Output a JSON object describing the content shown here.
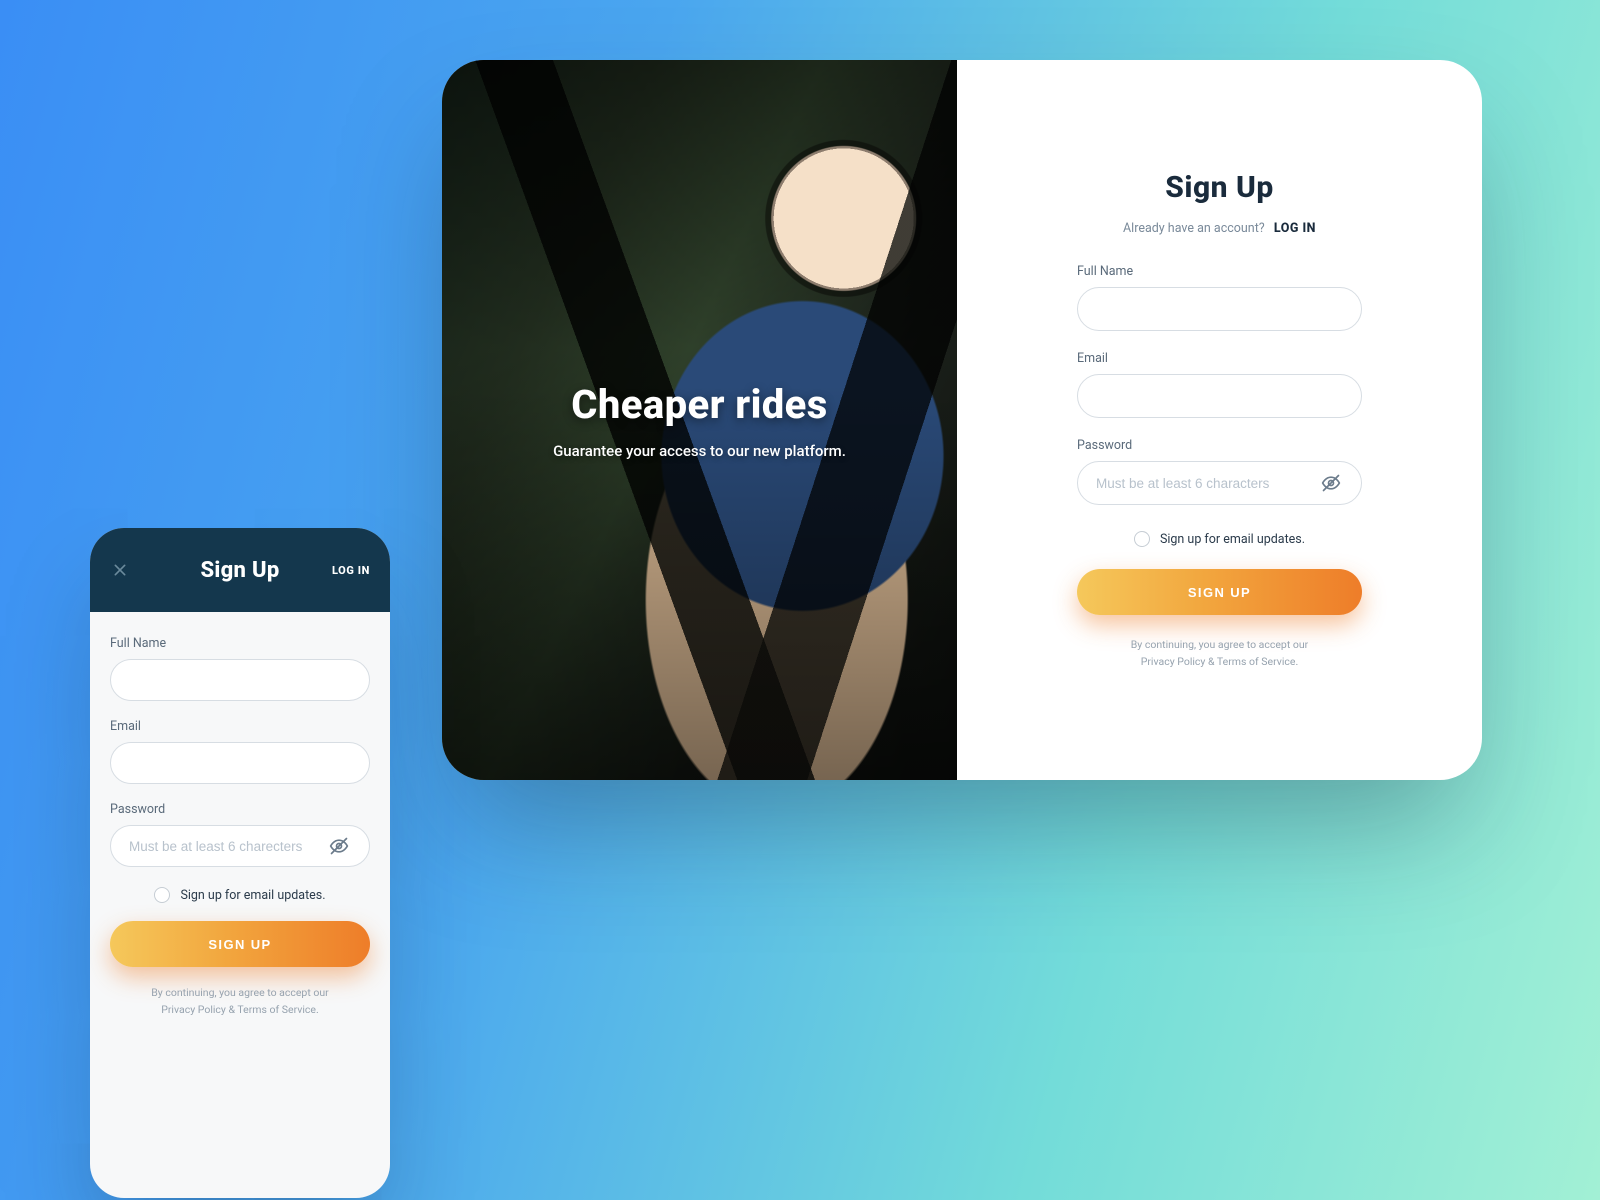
{
  "hero": {
    "title": "Cheaper rides",
    "subtitle": "Guarantee your access to our new platform."
  },
  "form": {
    "title": "Sign Up",
    "already_prompt": "Already have an account?",
    "login_link": "LOG IN",
    "full_name_label": "Full Name",
    "email_label": "Email",
    "password_label": "Password",
    "password_placeholder": "Must be at least 6 characters",
    "optin_label": "Sign up for email updates.",
    "cta": "SIGN UP",
    "legal_line1": "By continuing, you agree to accept our",
    "legal_line2": "Privacy Policy & Terms of Service."
  },
  "mobile": {
    "title": "Sign Up",
    "login_link": "LOG IN",
    "full_name_label": "Full Name",
    "email_label": "Email",
    "password_label": "Password",
    "password_placeholder": "Must be at least 6 charecters",
    "optin_label": "Sign up for email updates.",
    "cta": "SIGN UP",
    "legal_line1": "By continuing, you agree to accept our",
    "legal_line2": "Privacy Policy & Terms of Service."
  },
  "colors": {
    "cta_start": "#f5c85b",
    "cta_end": "#ee7d29",
    "header_bg": "#14374d"
  }
}
